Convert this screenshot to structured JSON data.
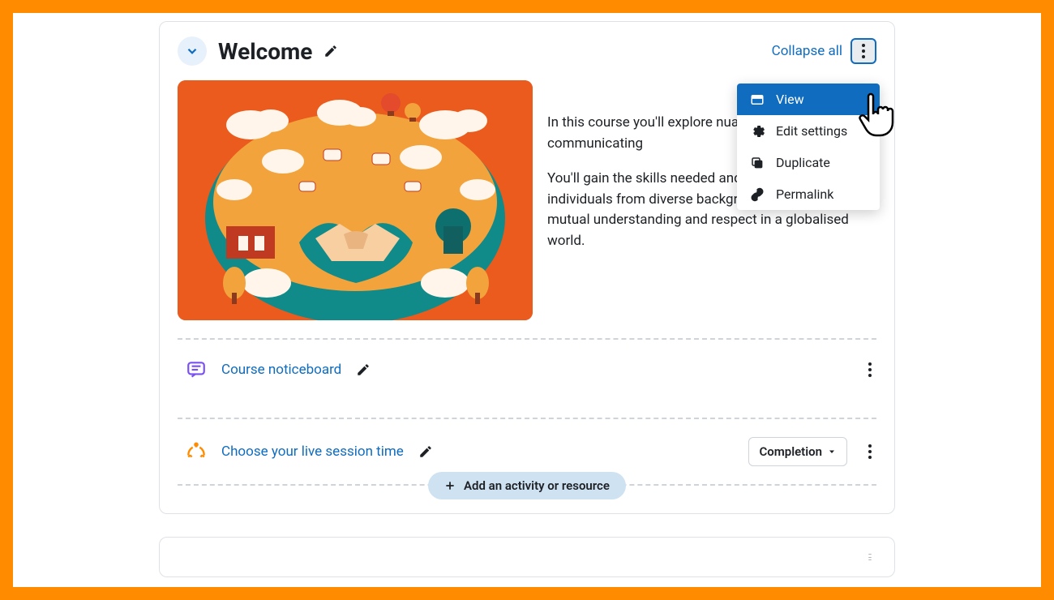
{
  "section": {
    "title": "Welcome",
    "collapse_label": "Collapse all",
    "description_p1": "In this course you'll explore nuances of communicating",
    "description_p2": "You'll gain the skills needed and collaborate with individuals from diverse backgrounds, fostering mutual understanding and respect in a globalised world."
  },
  "menu": {
    "view": "View",
    "edit_settings": "Edit settings",
    "duplicate": "Duplicate",
    "permalink": "Permalink"
  },
  "activities": [
    {
      "label": "Course noticeboard"
    },
    {
      "label": "Choose your live session time"
    }
  ],
  "completion_label": "Completion",
  "add_label": "Add an activity or resource"
}
